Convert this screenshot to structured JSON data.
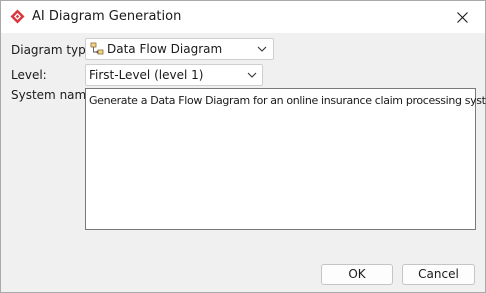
{
  "window": {
    "title": "AI Diagram Generation",
    "app_icon": "visual-paradigm-diamond-icon",
    "close_icon": "close-icon"
  },
  "form": {
    "diagram_type": {
      "label": "Diagram type:",
      "value": "Data Flow Diagram",
      "icon": "data-flow-diagram-icon"
    },
    "level": {
      "label": "Level:",
      "value": "First-Level (level 1)"
    },
    "system_name": {
      "label": "System name:",
      "value": "Generate a Data Flow Diagram for an online insurance claim processing system"
    }
  },
  "buttons": {
    "ok": "OK",
    "cancel": "Cancel"
  },
  "colors": {
    "app_icon": "#d9363e",
    "dialog_bg": "#f0f0f0",
    "title_bg": "#ffffff"
  }
}
